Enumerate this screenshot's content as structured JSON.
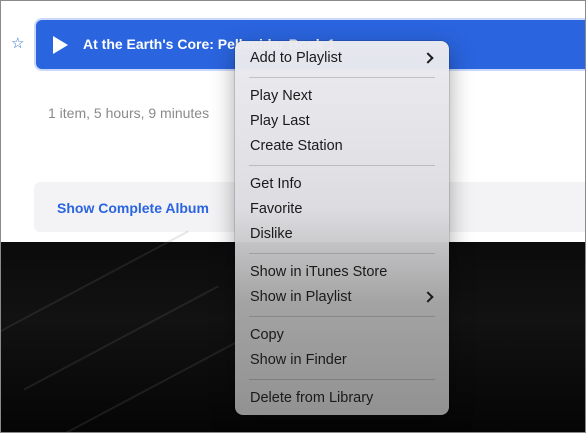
{
  "track": {
    "title": "At the Earth's Core: Pellucidar Book 1",
    "star_icon": "star-icon",
    "play_icon": "play-icon"
  },
  "album": {
    "summary": "1 item, 5 hours, 9 minutes",
    "show_complete_label": "Show Complete Album"
  },
  "context_menu": {
    "groups": [
      [
        {
          "label": "Add to Playlist",
          "submenu": true
        }
      ],
      [
        {
          "label": "Play Next",
          "submenu": false
        },
        {
          "label": "Play Last",
          "submenu": false
        },
        {
          "label": "Create Station",
          "submenu": false
        }
      ],
      [
        {
          "label": "Get Info",
          "submenu": false
        },
        {
          "label": "Favorite",
          "submenu": false
        },
        {
          "label": "Dislike",
          "submenu": false
        }
      ],
      [
        {
          "label": "Show in iTunes Store",
          "submenu": false
        },
        {
          "label": "Show in Playlist",
          "submenu": true
        }
      ],
      [
        {
          "label": "Copy",
          "submenu": false
        },
        {
          "label": "Show in Finder",
          "submenu": false
        }
      ],
      [
        {
          "label": "Delete from Library",
          "submenu": false
        }
      ]
    ]
  },
  "colors": {
    "accent": "#2a64de",
    "secondary_text": "#8a8a8a"
  }
}
